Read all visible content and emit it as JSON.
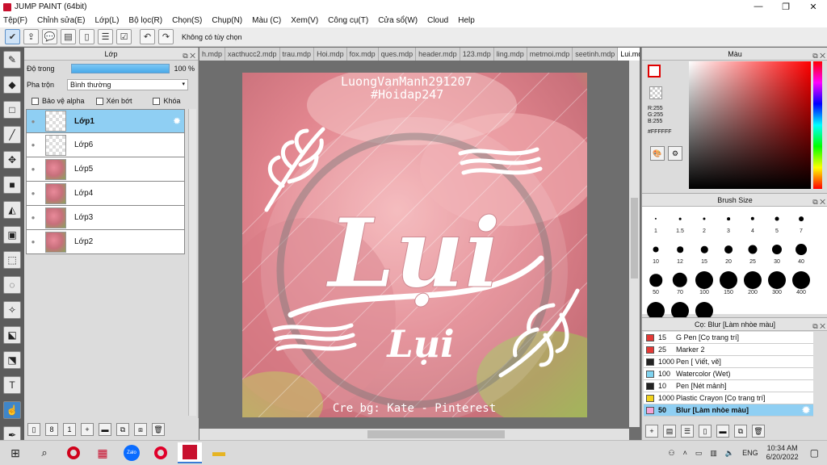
{
  "window": {
    "title": "JUMP PAINT (64bit)"
  },
  "menu": [
    "Tệp(F)",
    "Chỉnh sửa(E)",
    "Lớp(L)",
    "Bộ lọc(R)",
    "Chọn(S)",
    "Chụp(N)",
    "Màu (C)",
    "Xem(V)",
    "Công cụ(T)",
    "Cửa sổ(W)",
    "Cloud",
    "Help"
  ],
  "toolbar": {
    "status": "Không có tùy chọn"
  },
  "layer_panel": {
    "title": "Lớp",
    "opacity_label": "Độ trong",
    "opacity_value": "100 %",
    "opacity": 100,
    "blend_label": "Pha trộn",
    "blend_value": "Bình thường",
    "checks": [
      "Bảo vệ alpha",
      "Xén bớt",
      "Khóa"
    ],
    "layers": [
      "Lớp1",
      "Lớp6",
      "Lớp5",
      "Lớp4",
      "Lớp3",
      "Lớp2"
    ]
  },
  "tabs": [
    "h.mdp",
    "xacthucc2.mdp",
    "trau.mdp",
    "Hoi.mdp",
    "fox.mdp",
    "ques.mdp",
    "header.mdp",
    "123.mdp",
    "ling.mdp",
    "metmoi.mdp",
    "seetinh.mdp",
    "Lui.mdp"
  ],
  "canvas": {
    "line1": "LuongVanManh291207",
    "line2": "#Hoidap247",
    "big": "Lụi",
    "small": "Lụi",
    "credit": "Cre bg: Kate - Pinterest"
  },
  "color_panel": {
    "title": "Màu",
    "r": "R:255",
    "g": "G:255",
    "b": "B:255",
    "hex": "#FFFFFF"
  },
  "brush_panel": {
    "title": "Brush Size",
    "sizes": [
      "1",
      "1.5",
      "2",
      "3",
      "4",
      "5",
      "7",
      "10",
      "12",
      "15",
      "20",
      "25",
      "30",
      "40",
      "50",
      "70",
      "100",
      "150",
      "200",
      "300",
      "400"
    ]
  },
  "subtool_panel": {
    "title": "Cọ: Blur [Làm nhòe màu]",
    "items": [
      {
        "size": "15",
        "name": "G Pen [Cọ trang trí]",
        "color": "#e53935"
      },
      {
        "size": "25",
        "name": "Marker 2",
        "color": "#e53935"
      },
      {
        "size": "1000",
        "name": "Pen [ Viết, vẽ]",
        "color": "#222222"
      },
      {
        "size": "100",
        "name": "Watercolor (Wet)",
        "color": "#7fd3f0"
      },
      {
        "size": "10",
        "name": "Pen [Nét mảnh]",
        "color": "#222222"
      },
      {
        "size": "1000",
        "name": "Plastic Crayon [Cọ trang trí]",
        "color": "#f2d21c"
      },
      {
        "size": "50",
        "name": "Blur [Làm nhòe màu]",
        "color": "#f5a3d6"
      }
    ]
  },
  "taskbar": {
    "lang": "ENG",
    "time": "10:34 AM",
    "date": "6/20/2022"
  }
}
